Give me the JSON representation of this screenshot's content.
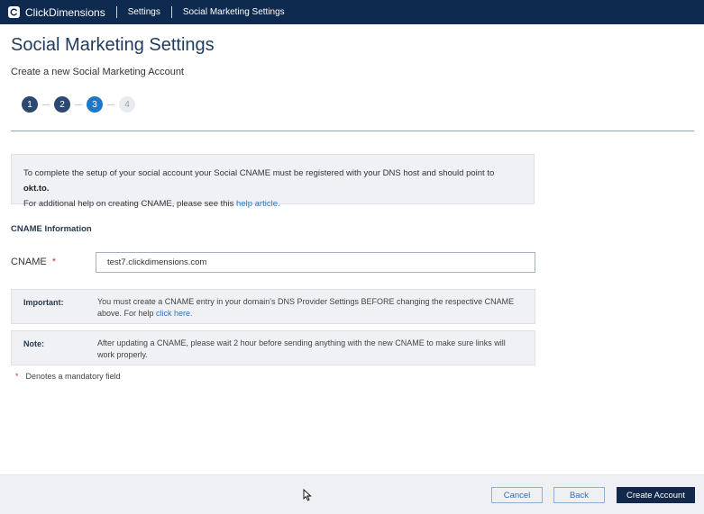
{
  "header": {
    "brand": "ClickDimensions",
    "crumbs": [
      "Settings",
      "Social Marketing Settings"
    ]
  },
  "page": {
    "title": "Social Marketing Settings",
    "subtitle": "Create a new Social Marketing Account"
  },
  "steps": {
    "items": [
      "1",
      "2",
      "3",
      "4"
    ],
    "current": 3
  },
  "info": {
    "line1_prefix": "To complete the setup of your social account your Social CNAME must be registered with your DNS host and should point to ",
    "line1_domain": "okt.to.",
    "line2_prefix": "For additional help on creating CNAME, please see this ",
    "line2_link": "help article."
  },
  "form": {
    "section_title": "CNAME Information",
    "cname_label": "CNAME",
    "required_mark": "*",
    "cname_value": "test7.clickdimensions.com"
  },
  "notes": {
    "important_label": "Important:",
    "important_text": "You must create a CNAME entry in your domain's DNS Provider Settings BEFORE changing the respective CNAME above. For help ",
    "important_link": "click here.",
    "note_label": "Note:",
    "note_text": "After updating a CNAME, please wait 2 hour before sending anything with the new CNAME to make sure links will work properly."
  },
  "mandatory": {
    "mark": "*",
    "text": "Denotes a mandatory field"
  },
  "footer": {
    "cancel_label": "Cancel",
    "back_label": "Back",
    "create_label": "Create Account"
  },
  "colors": {
    "header_bg": "#0e2a4f",
    "step_done": "#2c4770",
    "step_active": "#1e78c8",
    "link": "#2f74b5",
    "required": "#d0343a",
    "primary_button": "#13294b"
  },
  "icons": {
    "logo": "clickdimensions-logo-icon",
    "cursor": "mouse-pointer-icon"
  }
}
